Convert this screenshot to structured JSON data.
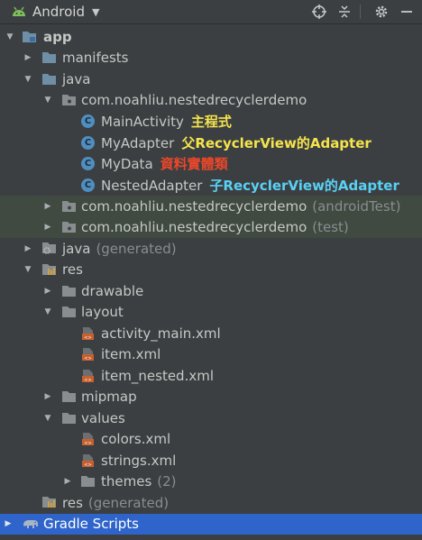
{
  "toolbar": {
    "title": "Android",
    "icons": [
      "android-icon",
      "chevron-down-icon",
      "crosshair-icon",
      "collapse-all-icon",
      "gear-icon",
      "minimize-icon"
    ]
  },
  "tree": {
    "app": "app",
    "manifests": "manifests",
    "java": "java",
    "pkg_main": "com.noahliu.nestedrecyclerdemo",
    "main_activity": "MainActivity",
    "main_activity_note": "主程式",
    "my_adapter": "MyAdapter",
    "my_adapter_note": "父RecyclerView的Adapter",
    "my_data": "MyData",
    "my_data_note": "資料實體類",
    "nested_adapter": "NestedAdapter",
    "nested_adapter_note": "子RecyclerView的Adapter",
    "pkg_android_test": "com.noahliu.nestedrecyclerdemo",
    "pkg_android_test_suffix": "(androidTest)",
    "pkg_test": "com.noahliu.nestedrecyclerdemo",
    "pkg_test_suffix": "(test)",
    "java_gen": "java",
    "java_gen_suffix": "(generated)",
    "res": "res",
    "drawable": "drawable",
    "layout": "layout",
    "activity_main": "activity_main.xml",
    "item": "item.xml",
    "item_nested": "item_nested.xml",
    "mipmap": "mipmap",
    "values": "values",
    "colors": "colors.xml",
    "strings": "strings.xml",
    "themes": "themes",
    "themes_count": "(2)",
    "res_gen": "res",
    "res_gen_suffix": "(generated)",
    "gradle": "Gradle Scripts"
  },
  "colors": {
    "background": "#3c3f41",
    "selected": "#2f65ca",
    "highlight": "#404a40",
    "annotation_yellow": "#f5e44d",
    "annotation_red": "#e8472b",
    "annotation_cyan": "#59d1f5"
  }
}
